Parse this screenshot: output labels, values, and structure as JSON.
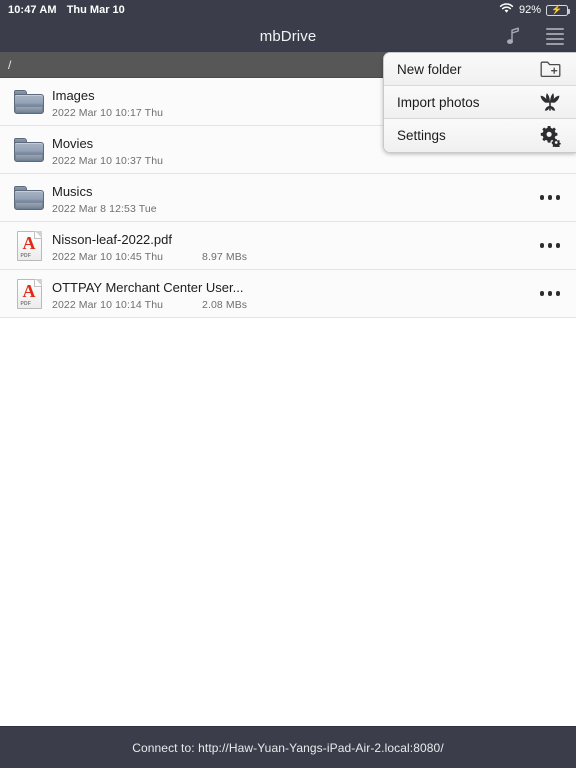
{
  "status_bar": {
    "time": "10:47 AM",
    "date": "Thu Mar 10",
    "battery_percent": "92%",
    "wifi_icon": "wifi-icon",
    "battery_icon": "battery-charging-icon"
  },
  "title_bar": {
    "title": "mbDrive",
    "music_icon": "music-note-icon",
    "menu_icon": "hamburger-menu-icon"
  },
  "path_bar": {
    "path": "/"
  },
  "file_list": {
    "more_icon": "more-options-icon",
    "rows": [
      {
        "name": "Images",
        "date": "2022 Mar 10  10:17 Thu",
        "size": "",
        "type": "folder"
      },
      {
        "name": "Movies",
        "date": "2022 Mar 10  10:37 Thu",
        "size": "",
        "type": "folder"
      },
      {
        "name": "Musics",
        "date": "2022 Mar 8  12:53 Tue",
        "size": "",
        "type": "folder"
      },
      {
        "name": "Nisson-leaf-2022.pdf",
        "date": "2022 Mar 10  10:45 Thu",
        "size": "8.97 MBs",
        "type": "pdf"
      },
      {
        "name": "OTTPAY Merchant Center User...",
        "date": "2022 Mar 10  10:14 Thu",
        "size": "2.08 MBs",
        "type": "pdf"
      }
    ]
  },
  "dropdown_menu": {
    "items": [
      {
        "label": "New folder",
        "icon": "new-folder-icon"
      },
      {
        "label": "Import photos",
        "icon": "tulip-photos-icon"
      },
      {
        "label": "Settings",
        "icon": "gear-settings-icon"
      }
    ]
  },
  "bottom_bar": {
    "connect_text": "Connect to: http://Haw-Yuan-Yangs-iPad-Air-2.local:8080/"
  },
  "colors": {
    "chrome": "#3b3e4a",
    "path_bar": "#575757",
    "battery_green": "#3bd24b",
    "pdf_red": "#e02a17",
    "list_bg": "#fbfbfb"
  }
}
